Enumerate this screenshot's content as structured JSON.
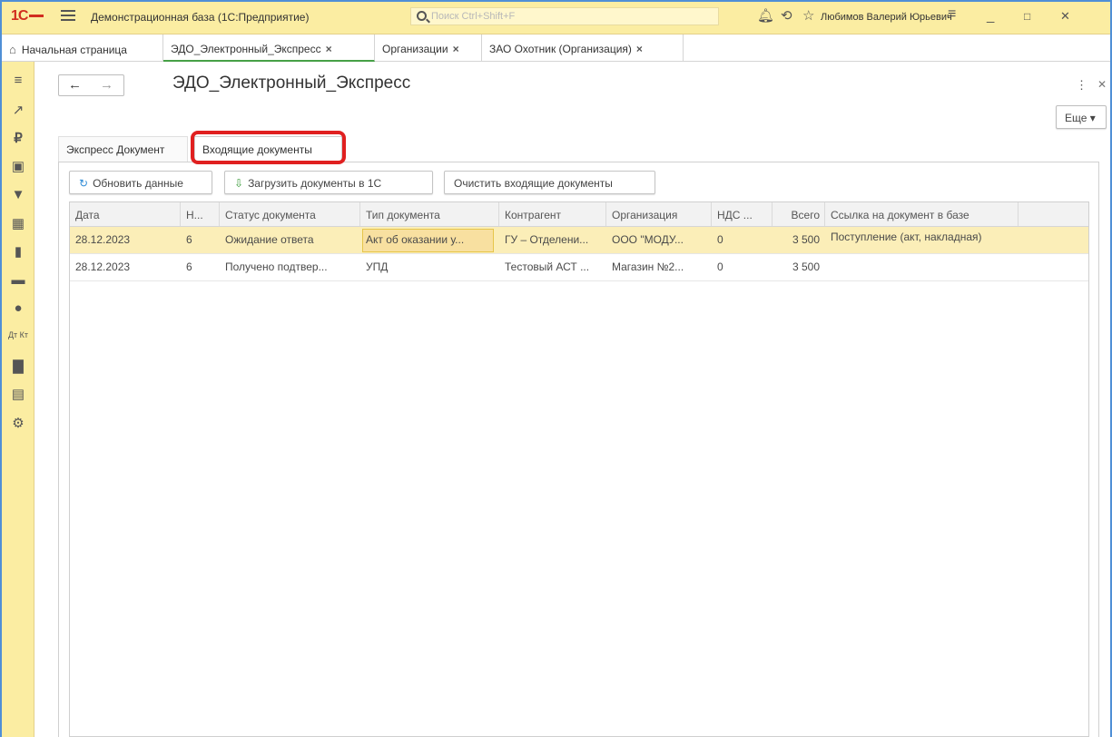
{
  "app": {
    "logo": "1С",
    "title": "Демонстрационная база (1С:Предприятие)",
    "search_placeholder": "Поиск Ctrl+Shift+F",
    "user": "Любимов Валерий Юрьевич"
  },
  "window_tabs": [
    {
      "label": "Начальная страница",
      "closable": false
    },
    {
      "label": "ЭДО_Электронный_Экспресс",
      "close": "×"
    },
    {
      "label": "Организации",
      "close": "×"
    },
    {
      "label": "ЗАО Охотник (Организация)",
      "close": "×"
    }
  ],
  "sidebar": {
    "icons": [
      "menu-icon",
      "trend-icon",
      "ruble-icon",
      "bag-icon",
      "cart-icon",
      "grid-icon",
      "factory-icon",
      "truck-icon",
      "person-icon",
      "dt-kt-icon",
      "bar-chart-icon",
      "docs-icon",
      "gear-icon"
    ],
    "dt_kt_label": "Дт Кт"
  },
  "form": {
    "title": "ЭДО_Электронный_Экспресс",
    "more_label": "Еще",
    "tabs": [
      "Экспресс Документ",
      "Входящие документы"
    ],
    "active_tab": 1,
    "commands": {
      "refresh": "Обновить данные",
      "load": "Загрузить документы в 1С",
      "clear": "Очистить входящие документы"
    }
  },
  "table": {
    "columns": [
      "Дата",
      "Н...",
      "Статус документа",
      "Тип документа",
      "Контрагент",
      "Организация",
      "НДС ...",
      "Всего",
      "Ссылка на документ в базе"
    ],
    "rows": [
      [
        "28.12.2023",
        "6",
        "Ожидание ответа",
        "Акт об оказании у...",
        "ГУ – Отделени...",
        "ООО \"МОДУ...",
        "0",
        "3 500",
        "Поступление (акт, накладная)"
      ],
      [
        "28.12.2023",
        "6",
        "Получено подтвер...",
        "УПД",
        "Тестовый АСТ ...",
        "Магазин №2...",
        "0",
        "3 500",
        ""
      ]
    ],
    "selected_row": 0
  },
  "colors": {
    "title_bar": "#fbeda2",
    "selected_row": "#fbeeb8",
    "highlight": "#e02020",
    "active_tab_underline": "#46a046"
  }
}
